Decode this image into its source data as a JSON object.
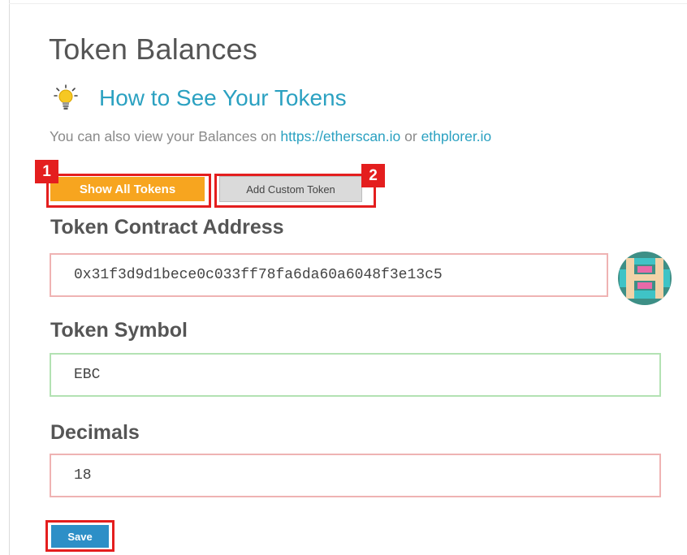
{
  "header": {
    "title": "Token Balances",
    "howto_link": "How to See Your Tokens",
    "subtext_prefix": "You can also view your Balances on ",
    "subtext_link1": "https://etherscan.io",
    "subtext_or": " or ",
    "subtext_link2": "ethplorer.io"
  },
  "buttons": {
    "show_all": "Show All Tokens",
    "add_custom": "Add Custom Token",
    "save": "Save"
  },
  "annotations": {
    "badge1": "1",
    "badge2": "2",
    "highlight_color": "#e41e1e"
  },
  "form": {
    "contract_label": "Token Contract Address",
    "contract_value": "0x31f3d9d1bece0c033ff78fa6da60a6048f3e13c5",
    "symbol_label": "Token Symbol",
    "symbol_value": "EBC",
    "decimals_label": "Decimals",
    "decimals_value": "18"
  },
  "icons": {
    "bulb": "lightbulb-icon",
    "identicon": "address-identicon"
  },
  "colors": {
    "accent_orange": "#f7a51f",
    "link_blue": "#2ba1c1",
    "save_blue": "#2d8fc7",
    "invalid_border": "#efb3b3",
    "valid_border": "#b3e2b3"
  }
}
